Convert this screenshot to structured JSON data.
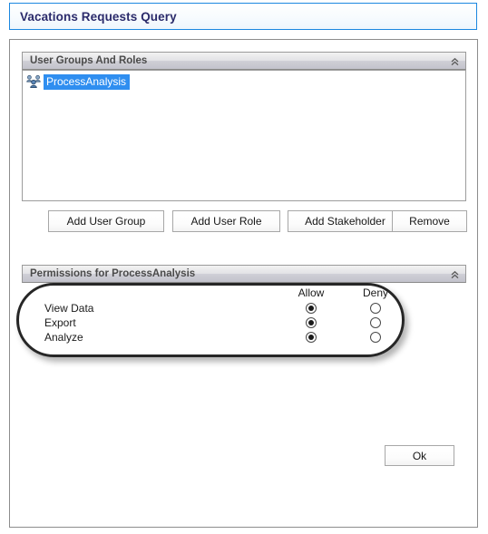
{
  "window": {
    "title": "Vacations Requests Query"
  },
  "colors": {
    "title_text": "#2b2b6b",
    "title_border": "#1b87e0",
    "selection_background": "#2f8ef0",
    "selection_text": "#ffffff",
    "panel_header_text": "#4a4a4a",
    "annotation_stroke": "#262626"
  },
  "user_groups_panel": {
    "header": "User Groups And Roles",
    "collapse_icon": "double-chevron-up-icon",
    "items": [
      {
        "label": "ProcessAnalysis",
        "icon": "user-group-icon",
        "selected": true
      }
    ],
    "buttons": [
      {
        "label": "Add User Group"
      },
      {
        "label": "Add User Role"
      },
      {
        "label": "Add Stakeholder"
      },
      {
        "label": "Remove"
      }
    ]
  },
  "permissions_panel": {
    "header": "Permissions for ProcessAnalysis",
    "collapse_icon": "double-chevron-up-icon",
    "columns": {
      "allow": "Allow",
      "deny": "Deny"
    },
    "rows": [
      {
        "label": "View Data",
        "allow": true,
        "deny": false
      },
      {
        "label": "Export",
        "allow": true,
        "deny": false
      },
      {
        "label": "Analyze",
        "allow": true,
        "deny": false
      }
    ]
  },
  "footer": {
    "ok_label": "Ok"
  }
}
